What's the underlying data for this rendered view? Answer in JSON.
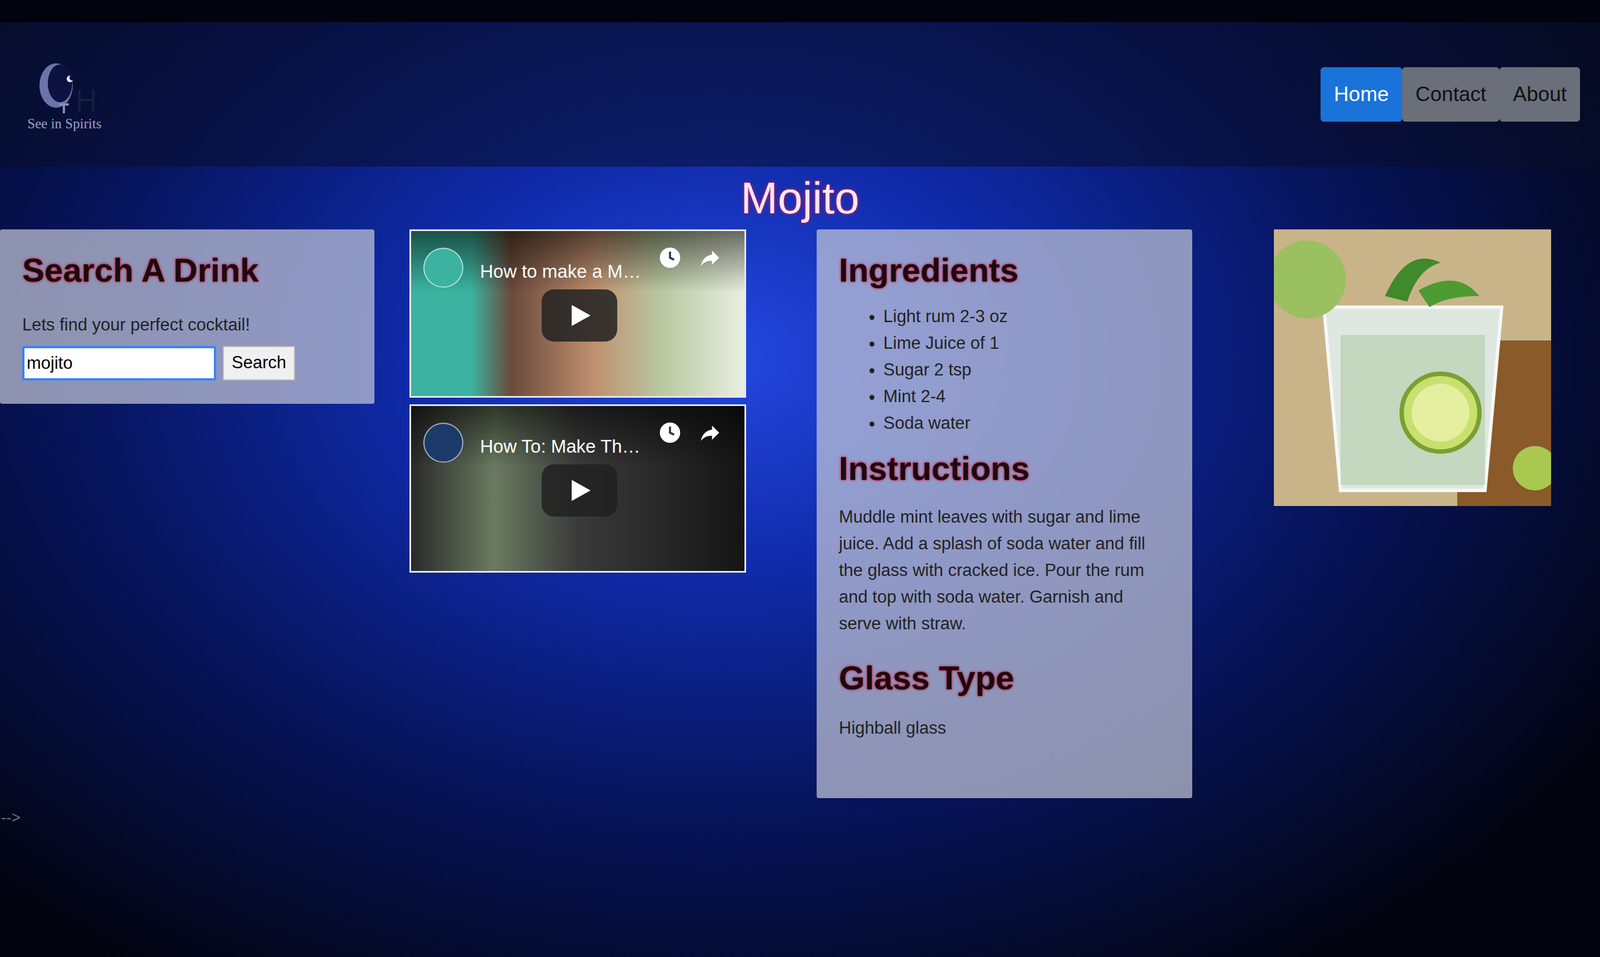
{
  "logo": {
    "caption": "See in Spirits"
  },
  "nav": [
    {
      "label": "Home",
      "selected": true
    },
    {
      "label": "Contact",
      "selected": false
    },
    {
      "label": "About",
      "selected": false
    }
  ],
  "title": "Mojito",
  "search": {
    "heading": "Search A Drink",
    "prompt": "Lets find your perfect cocktail!",
    "value": "mojito",
    "button": "Search"
  },
  "videos": [
    {
      "title": "How to make a M…"
    },
    {
      "title": "How To: Make Th…"
    }
  ],
  "ingredients": {
    "heading": "Ingredients",
    "items": [
      "Light rum 2-3 oz",
      "Lime Juice of 1",
      "Sugar 2 tsp",
      "Mint 2-4",
      "Soda water"
    ]
  },
  "instructions": {
    "heading": "Instructions",
    "text": "Muddle mint leaves with sugar and lime juice. Add a splash of soda water and fill the glass with cracked ice. Pour the rum and top with soda water. Garnish and serve with straw."
  },
  "glass": {
    "heading": "Glass Type",
    "text": "Highball glass"
  },
  "stray_text": "-->"
}
